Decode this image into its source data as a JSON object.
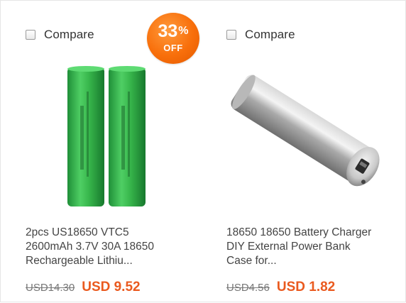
{
  "products": [
    {
      "compare_label": "Compare",
      "discount": {
        "value": "33",
        "percent_sign": "%",
        "label": "OFF"
      },
      "title_lines": [
        "2pcs US18650 VTC5",
        "2600mAh 3.7V 30A 18650",
        "Rechargeable Lithiu..."
      ],
      "old_price": "USD14.30",
      "price": "USD 9.52",
      "image_icon": "green-18650-battery-pair",
      "battery_color": "#36b44a"
    },
    {
      "compare_label": "Compare",
      "title_lines": [
        "18650 18650 Battery Charger",
        "DIY External Power Bank",
        "Case for..."
      ],
      "old_price": "USD4.56",
      "price": "USD 1.82",
      "image_icon": "silver-power-bank-tube"
    }
  ],
  "colors": {
    "accent": "#ea5a1f",
    "badge": "#f86f0b"
  }
}
